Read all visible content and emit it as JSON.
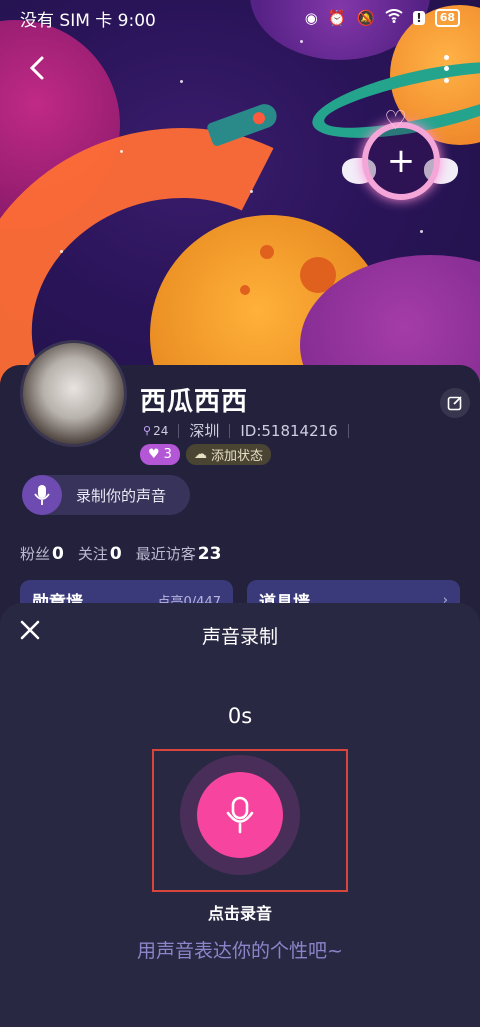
{
  "status_bar": {
    "carrier_time": "没有 SIM 卡 9:00",
    "battery": "68",
    "icons": [
      "eye-icon",
      "alarm-icon",
      "mute-icon",
      "wifi-icon",
      "alert-icon",
      "battery-icon"
    ]
  },
  "profile": {
    "nickname": "西瓜西西",
    "level": "24",
    "city": "深圳",
    "user_id": "ID:51814216",
    "heart_count": "3",
    "add_status": "添加状态",
    "record_voice": "录制你的声音"
  },
  "stats": {
    "fans_label": "粉丝",
    "fans": "0",
    "following_label": "关注",
    "following": "0",
    "visitors_label": "最近访客",
    "visitors": "23"
  },
  "cards": [
    {
      "title": "勋章墙",
      "sub": "点亮0/447"
    },
    {
      "title": "道具墙",
      "sub": ""
    }
  ],
  "recorder": {
    "title": "声音录制",
    "timer": "0s",
    "tap_label": "点击录音",
    "hint": "用声音表达你的个性吧~"
  },
  "colors": {
    "record_button": "#f7459f",
    "highlight_box": "#d8453d",
    "sheet_bg": "#292843"
  }
}
